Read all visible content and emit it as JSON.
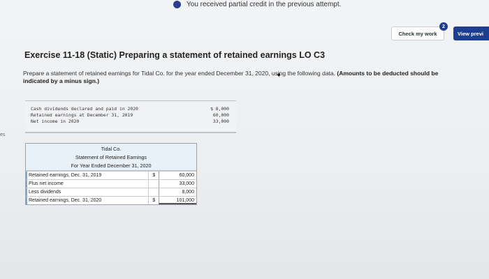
{
  "banner": {
    "text": "You received partial credit in the previous attempt."
  },
  "toolbar": {
    "check_label": "Check my work",
    "check_badge": "2",
    "view_label": "View previ"
  },
  "side_mark": "es",
  "exercise": {
    "title": "Exercise 11-18 (Static) Preparing a statement of retained earnings LO C3",
    "instructions": "Prepare a statement of retained earnings for Tidal Co. for the year ended December 31, 2020, using the following data.",
    "instructions_bold": "(Amounts to be deducted should be indicated by a minus sign.)"
  },
  "given_data": [
    {
      "label": "Cash dividends declared and paid in 2020",
      "value": "$ 8,000"
    },
    {
      "label": "Retained earnings at December 31, 2019",
      "value": "60,000"
    },
    {
      "label": "Net income in 2020",
      "value": "33,000"
    }
  ],
  "statement": {
    "company": "Tidal Co.",
    "name": "Statement of Retained Earnings",
    "period": "For Year Ended December 31, 2020",
    "rows": [
      {
        "label": "Retained earnings, Dec. 31, 2019",
        "currency": "$",
        "amount": "60,000"
      },
      {
        "label": "Plus net income",
        "currency": "",
        "amount": "33,000"
      },
      {
        "label": "Less dividends",
        "currency": "",
        "amount": "8,000"
      },
      {
        "label": "Retained earnings, Dec. 31, 2020",
        "currency": "$",
        "amount": "101,000"
      }
    ]
  },
  "colors": {
    "accent": "#1e3f8f",
    "table_header_bg": "#e8f1f8",
    "input_border": "#7fa6c8"
  }
}
